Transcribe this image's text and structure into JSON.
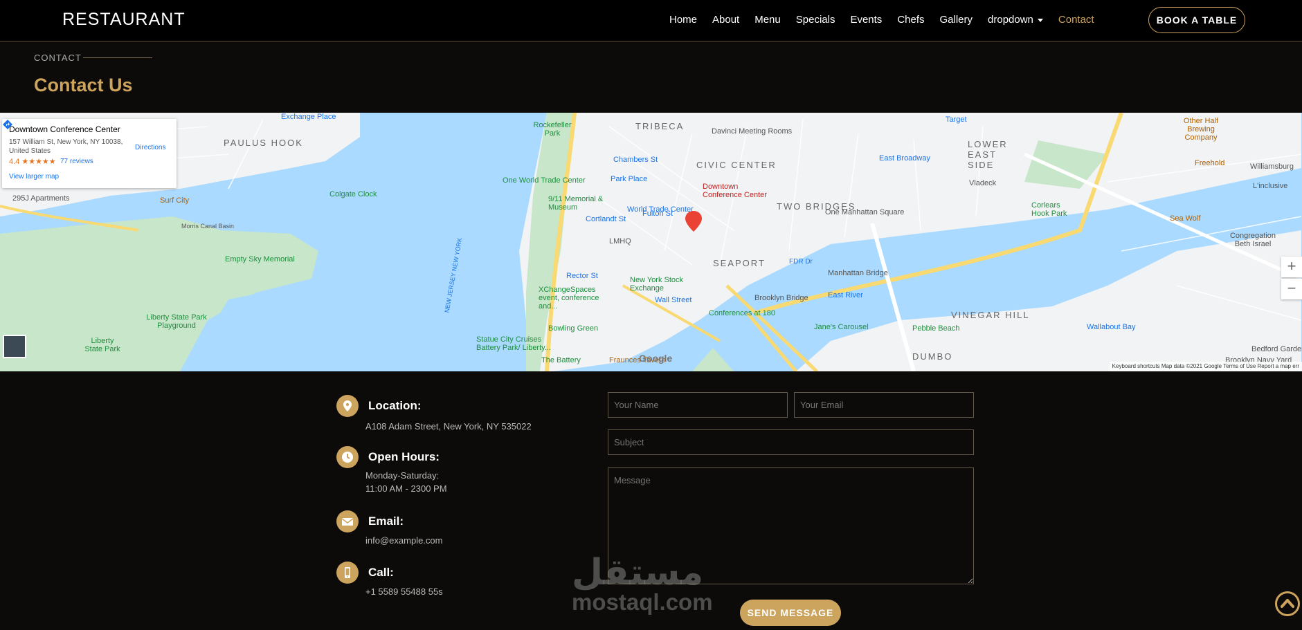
{
  "header": {
    "brand": "RESTAURANT",
    "nav": [
      "Home",
      "About",
      "Menu",
      "Specials",
      "Events",
      "Chefs",
      "Gallery",
      "dropdown",
      "Contact"
    ],
    "active": "Contact",
    "book_label": "BOOK A TABLE"
  },
  "breadcrumb": "CONTACT",
  "page_title": "Contact Us",
  "map": {
    "place_name": "Downtown Conference Center",
    "address": "157 William St, New York, NY 10038, United States",
    "rating": "4.4 ★★★★★",
    "reviews": "77 reviews",
    "directions": "Directions",
    "larger_map": "View larger map",
    "marker_label": "Downtown Conference Center",
    "zoom_in": "+",
    "zoom_out": "−",
    "google": "Google",
    "footer": "Keyboard shortcuts   Map data ©2021 Google   Terms of Use   Report a map err",
    "labels": {
      "paulus_hook": "PAULUS HOOK",
      "tribeca": "TRIBECA",
      "civic_center": "CIVIC CENTER",
      "lower_east_side": "LOWER EAST SIDE",
      "two_bridges": "TWO BRIDGES",
      "seaport": "SEAPORT",
      "vinegar_hill": "VINEGAR HILL",
      "dumbo": "DUMBO",
      "exchange_place": "Exchange Place",
      "colgate_clock": "Colgate Clock",
      "surf_city": "Surf City",
      "apartments": "295J Apartments",
      "morris_canal": "Morris Canal Basin",
      "empty_sky": "Empty Sky Memorial",
      "liberty_playground": "Liberty State Park Playground",
      "liberty_park": "Liberty State Park",
      "one_wtc": "One World Trade Center",
      "memorial": "9/11 Memorial & Museum",
      "wtc": "World Trade Center",
      "cortlandt": "Cortlandt St",
      "lmhq": "LMHQ",
      "fulton": "Fulton St",
      "chambers": "Chambers St",
      "park_place": "Park Place",
      "davinci": "Davinci Meeting Rooms",
      "target": "Target",
      "east_broadway": "East Broadway",
      "vladeck": "Vladeck",
      "one_manhattan": "One Manhattan Square",
      "corlears": "Corlears Hook Park",
      "nyse": "New York Stock Exchange",
      "wall_st": "Wall Street",
      "xchange": "XChangeSpaces event, conference and...",
      "rector": "Rector St",
      "bowling": "Bowling Green",
      "statue": "Statue City Cruises Battery Park/ Liberty...",
      "battery": "The Battery",
      "fraunces": "Fraunces Tavern",
      "conferences": "Conferences at 180",
      "brooklyn_bridge": "Brooklyn Bridge",
      "manhattan_bridge": "Manhattan Bridge",
      "janes": "Jane's Carousel",
      "pebble": "Pebble Beach",
      "other_half": "Other Half Brewing Company",
      "freehold": "Freehold",
      "williamsburg": "Williamsburg",
      "sea_wolf": "Sea Wolf",
      "congregation": "Congregation Beth Israel",
      "navy_yard": "Brooklyn Navy Yard",
      "bedford": "Bedford Gardens",
      "fdr": "FDR Dr",
      "east_river": "East River",
      "wallabout": "Wallabout Bay",
      "rockefeller": "Rockefeller Park",
      "l_inclusive": "L'inclusive",
      "new_jersey": "NEW JERSEY NEW YORK"
    }
  },
  "contact": {
    "location_title": "Location:",
    "location_text": "A108 Adam Street, New York, NY 535022",
    "hours_title": "Open Hours:",
    "hours_line1": "Monday-Saturday:",
    "hours_line2": "11:00 AM - 2300 PM",
    "email_title": "Email:",
    "email_text": "info@example.com",
    "call_title": "Call:",
    "call_text": "+1 5589 55488 55s"
  },
  "form": {
    "name_placeholder": "Your Name",
    "email_placeholder": "Your Email",
    "subject_placeholder": "Subject",
    "message_placeholder": "Message",
    "send_label": "SEND MESSAGE"
  },
  "watermark": {
    "arabic": "مستقل",
    "english": "mostaql.com"
  },
  "colors": {
    "accent": "#cda45e",
    "background": "#0c0b09",
    "header": "#000000",
    "water": "#aadaff"
  }
}
